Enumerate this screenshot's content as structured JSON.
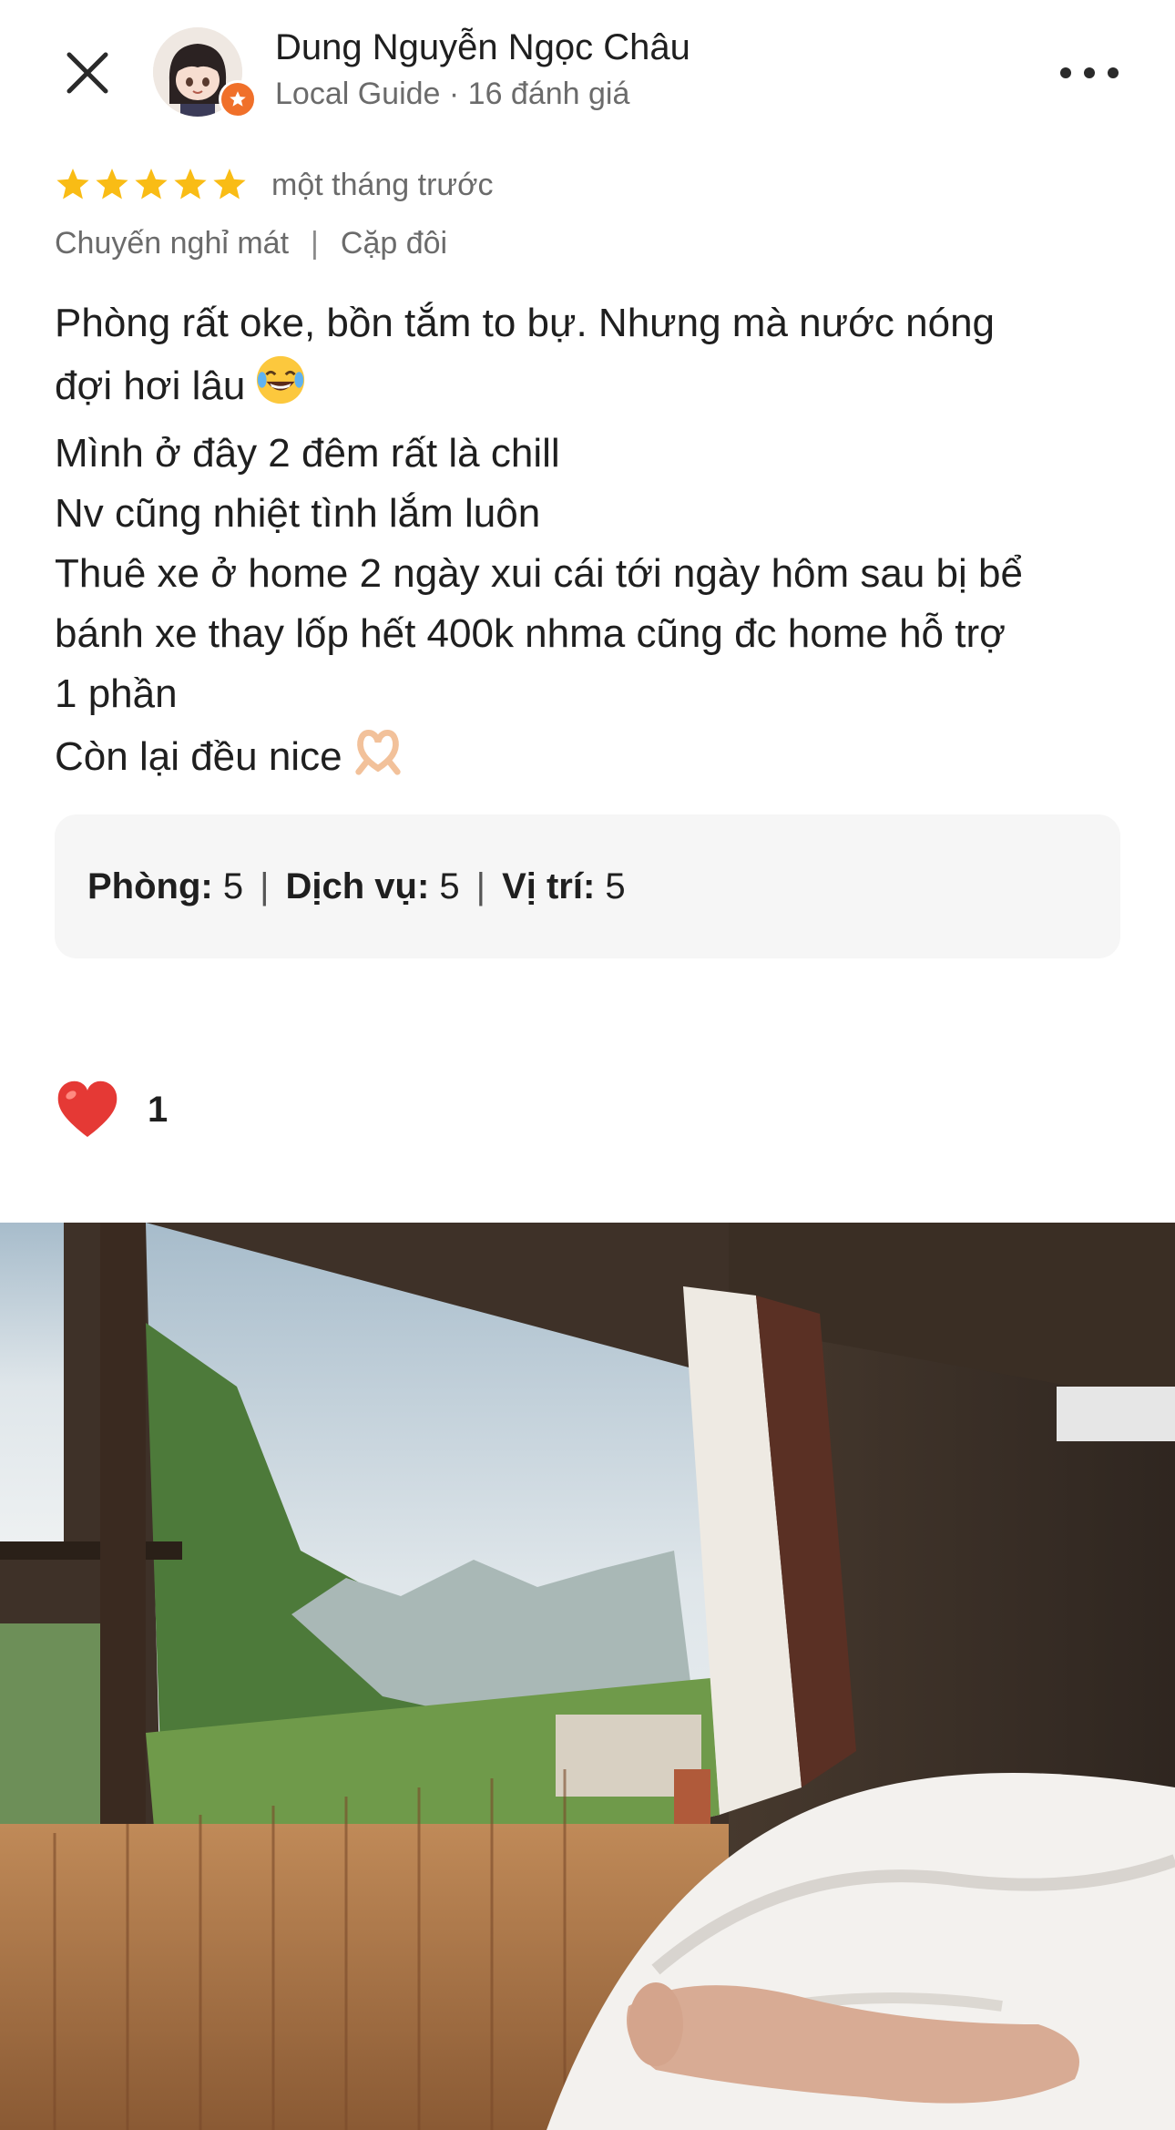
{
  "header": {
    "author_name": "Dung Nguyễn Ngọc Châu",
    "author_meta": "Local Guide · 16 đánh giá"
  },
  "review": {
    "stars": 5,
    "time_ago": "một tháng trước",
    "trip_type": "Chuyến nghỉ mát",
    "companions": "Cặp đôi",
    "lines": [
      "Phòng rất oke, bồn tắm to bự. Nhưng mà nước nóng",
      "đợi hơi lâu",
      "Mình ở đây 2 đêm rất là chill",
      "Nv cũng nhiệt tình lắm luôn",
      "Thuê xe ở home 2 ngày xui cái tới ngày hôm sau bị bể",
      "bánh xe thay lốp hết 400k nhma cũng đc home hỗ trợ",
      "1 phần",
      "Còn lại đều nice"
    ]
  },
  "sub_ratings": {
    "room_label": "Phòng:",
    "room_value": "5",
    "service_label": "Dịch vụ:",
    "service_value": "5",
    "location_label": "Vị trí:",
    "location_value": "5"
  },
  "likes": {
    "count": "1"
  },
  "colors": {
    "star": "#f9bc15",
    "heart": "#e53935",
    "badge": "#f0702a",
    "meta_text": "#6b6b6b"
  },
  "icons": [
    "close-icon",
    "more-icon",
    "star-icon",
    "heart-icon",
    "local-guide-badge-icon"
  ]
}
